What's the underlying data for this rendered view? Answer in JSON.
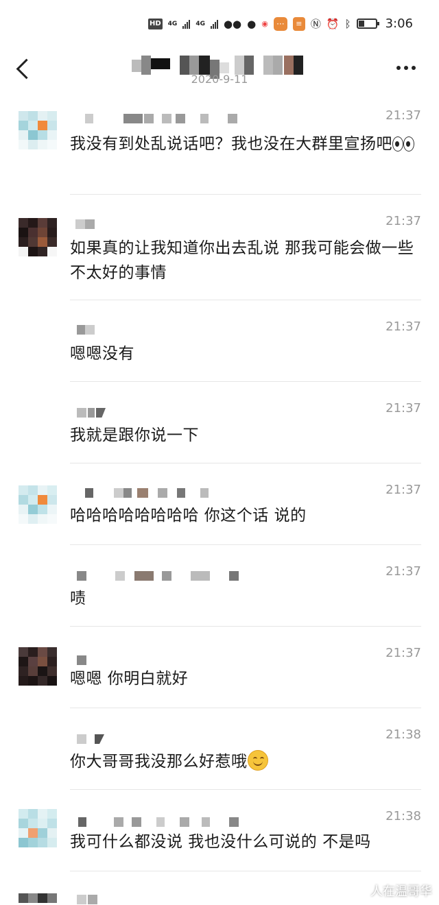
{
  "status_bar": {
    "time": "3:06",
    "hd": "HD",
    "net1": "4G",
    "net2": "4G",
    "battery_level": 0.35
  },
  "header": {
    "date": "2020-9-11"
  },
  "messages": [
    {
      "time": "21:37",
      "text": "我没有到处乱说话吧？我也没在大群里宣扬吧",
      "has_avatar": true,
      "emoji": "eyes"
    },
    {
      "time": "21:37",
      "text": "如果真的让我知道你出去乱说 那我可能会做一些不太好的事情",
      "has_avatar": true
    },
    {
      "time": "21:37",
      "text": "嗯嗯没有",
      "has_avatar": false
    },
    {
      "time": "21:37",
      "text": "我就是跟你说一下",
      "has_avatar": false
    },
    {
      "time": "21:37",
      "text": "哈哈哈哈哈哈哈哈 你这个话 说的",
      "has_avatar": true
    },
    {
      "time": "21:37",
      "text": "啧",
      "has_avatar": false
    },
    {
      "time": "21:37",
      "text": "嗯嗯 你明白就好",
      "has_avatar": true
    },
    {
      "time": "21:38",
      "text": "你大哥哥我没那么好惹哦",
      "has_avatar": false,
      "emoji": "smile"
    },
    {
      "time": "21:38",
      "text": "我可什么都没说 我也没什么可说的 不是吗",
      "has_avatar": true
    },
    {
      "time": "21:38",
      "text": "",
      "has_avatar": true
    }
  ],
  "watermark": "人在温哥华"
}
